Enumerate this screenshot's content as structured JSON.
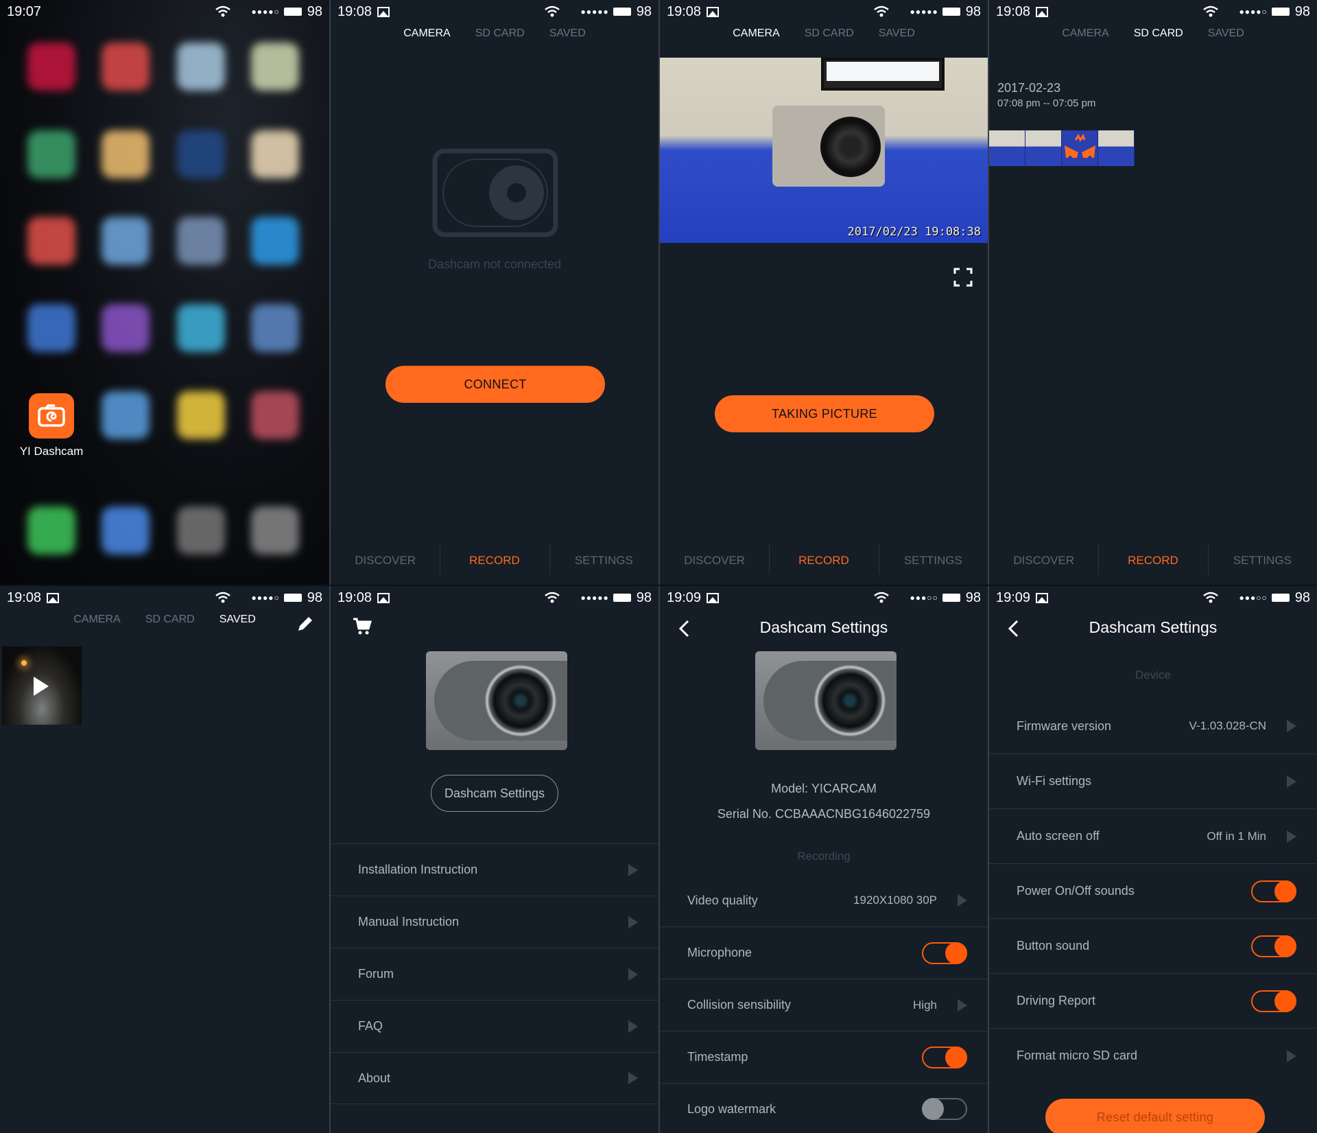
{
  "colors": {
    "accent": "#ff6a1f",
    "background": "#151d26",
    "muted_text": "#6b7480"
  },
  "screens": {
    "home": {
      "status": {
        "time": "19:07",
        "battery": "98"
      },
      "app": {
        "label": "YI Dashcam",
        "icon": "yi-dashcam-app-icon"
      }
    },
    "connect": {
      "status": {
        "time": "19:08",
        "battery": "98"
      },
      "tabs": [
        "CAMERA",
        "SD CARD",
        "SAVED"
      ],
      "active_tab": "CAMERA",
      "message": "Dashcam not connected",
      "button": "CONNECT",
      "nav": [
        "DISCOVER",
        "RECORD",
        "SETTINGS"
      ],
      "active_nav": "RECORD"
    },
    "live": {
      "status": {
        "time": "19:08",
        "battery": "98"
      },
      "tabs": [
        "CAMERA",
        "SD CARD",
        "SAVED"
      ],
      "active_tab": "CAMERA",
      "timestamp": "2017/02/23  19:08:38",
      "button": "TAKING PICTURE",
      "nav": [
        "DISCOVER",
        "RECORD",
        "SETTINGS"
      ],
      "active_nav": "RECORD"
    },
    "sdcard": {
      "status": {
        "time": "19:08",
        "battery": "98"
      },
      "tabs": [
        "CAMERA",
        "SD CARD",
        "SAVED"
      ],
      "active_tab": "SD CARD",
      "date": "2017-02-23",
      "range": "07:08 pm -- 07:05 pm",
      "nav": [
        "DISCOVER",
        "RECORD",
        "SETTINGS"
      ],
      "active_nav": "RECORD"
    },
    "saved": {
      "status": {
        "time": "19:08",
        "battery": "98"
      },
      "tabs": [
        "CAMERA",
        "SD CARD",
        "SAVED"
      ],
      "active_tab": "SAVED"
    },
    "discover": {
      "status": {
        "time": "19:08",
        "battery": "98"
      },
      "settings_button": "Dashcam Settings",
      "items": [
        "Installation Instruction",
        "Manual Instruction",
        "Forum",
        "FAQ",
        "About"
      ]
    },
    "settings1": {
      "status": {
        "time": "19:09",
        "battery": "98"
      },
      "title": "Dashcam Settings",
      "model": "Model: YICARCAM",
      "serial": "Serial No. CCBAAACNBG1646022759",
      "section": "Recording",
      "items": [
        {
          "label": "Video quality",
          "value": "1920X1080 30P",
          "type": "arrow"
        },
        {
          "label": "Microphone",
          "type": "toggle",
          "on": true
        },
        {
          "label": "Collision sensibility",
          "value": "High",
          "type": "arrow"
        },
        {
          "label": "Timestamp",
          "type": "toggle",
          "on": true
        },
        {
          "label": "Logo watermark",
          "type": "toggle",
          "on": false
        }
      ]
    },
    "settings2": {
      "status": {
        "time": "19:09",
        "battery": "98"
      },
      "title": "Dashcam Settings",
      "section": "Device",
      "items": [
        {
          "label": "Firmware version",
          "value": "V-1.03.028-CN",
          "type": "arrow"
        },
        {
          "label": "Wi-Fi settings",
          "value": "",
          "type": "arrow"
        },
        {
          "label": "Auto screen off",
          "value": "Off in 1 Min",
          "type": "arrow"
        },
        {
          "label": "Power On/Off sounds",
          "type": "toggle",
          "on": true
        },
        {
          "label": "Button sound",
          "type": "toggle",
          "on": true
        },
        {
          "label": "Driving Report",
          "type": "toggle",
          "on": true
        },
        {
          "label": "Format micro SD card",
          "value": "",
          "type": "arrow"
        }
      ],
      "reset_button": "Reset default setting"
    }
  }
}
